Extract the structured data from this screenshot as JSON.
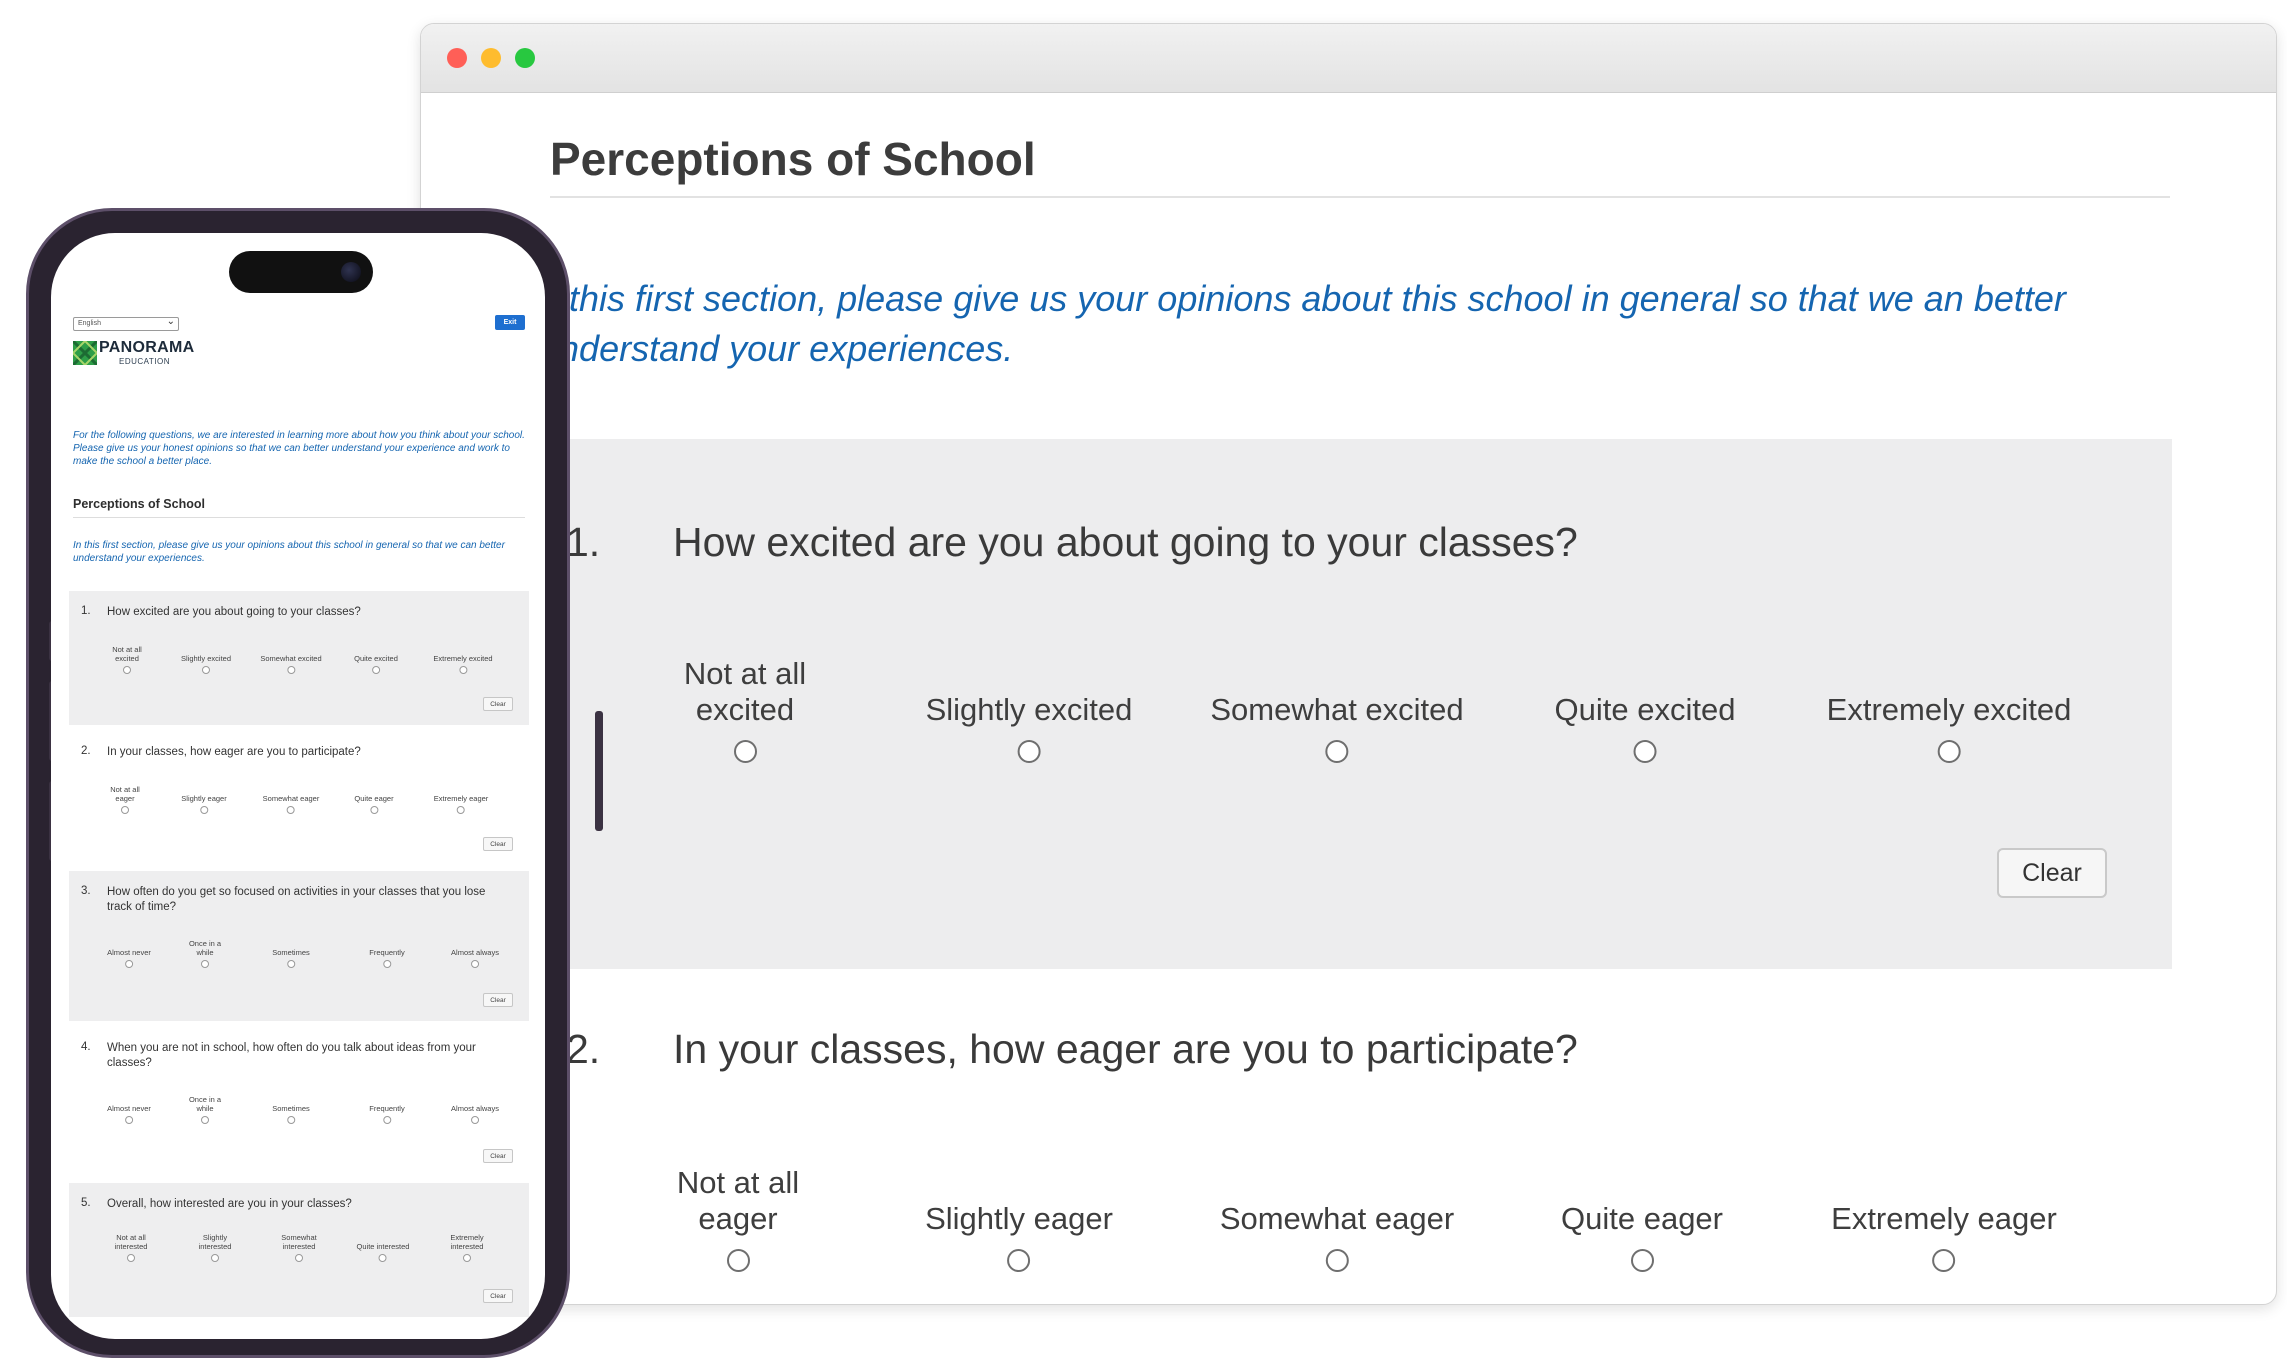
{
  "window": {
    "controls": [
      "close",
      "minimize",
      "maximize"
    ]
  },
  "desktop": {
    "section_title": "Perceptions of School",
    "intro": "n this first section, please give us your opinions about this school in general so that we an better understand your experiences.",
    "questions": [
      {
        "number": "1.",
        "text": "How excited are you about going to your classes?",
        "options": [
          "Not at all excited",
          "Slightly excited",
          "Somewhat excited",
          "Quite excited",
          "Extremely excited"
        ],
        "clear_label": "Clear"
      },
      {
        "number": "2.",
        "text": "In your classes, how eager are you to participate?",
        "options": [
          "Not at all eager",
          "Slightly eager",
          "Somewhat eager",
          "Quite eager",
          "Extremely eager"
        ]
      }
    ]
  },
  "mobile": {
    "language": "English",
    "exit_label": "Exit",
    "brand": "PANORAMA",
    "brand_sub": "EDUCATION",
    "intro": "For the following questions, we are interested in learning more about how you think about your school. Please give us your honest opinions so that we can better understand your experience and work to make the school a better place.",
    "section_title": "Perceptions of School",
    "section_intro": "In this first section, please give us your opinions about this school in general so that we can better understand your experiences.",
    "clear_label": "Clear",
    "questions": [
      {
        "number": "1.",
        "text": "How excited are you about going to your classes?",
        "options": [
          "Not at all excited",
          "Slightly excited",
          "Somewhat excited",
          "Quite excited",
          "Extremely excited"
        ]
      },
      {
        "number": "2.",
        "text": "In your classes, how eager are you to participate?",
        "options": [
          "Not at all eager",
          "Slightly eager",
          "Somewhat eager",
          "Quite eager",
          "Extremely eager"
        ]
      },
      {
        "number": "3.",
        "text": "How often do you get so focused on activities in your classes that you lose track of time?",
        "options": [
          "Almost never",
          "Once in a while",
          "Sometimes",
          "Frequently",
          "Almost always"
        ]
      },
      {
        "number": "4.",
        "text": "When you are not in school, how often do you talk about ideas from your classes?",
        "options": [
          "Almost never",
          "Once in a while",
          "Sometimes",
          "Frequently",
          "Almost always"
        ]
      },
      {
        "number": "5.",
        "text": "Overall, how interested are you in your classes?",
        "options": [
          "Not at all interested",
          "Slightly interested",
          "Somewhat interested",
          "Quite interested",
          "Extremely interested"
        ]
      }
    ]
  },
  "colors": {
    "accent": "#1565b0",
    "exit_button": "#1e6fd0",
    "question_shade": "#ededee",
    "phone_frame": "#2a2330"
  }
}
